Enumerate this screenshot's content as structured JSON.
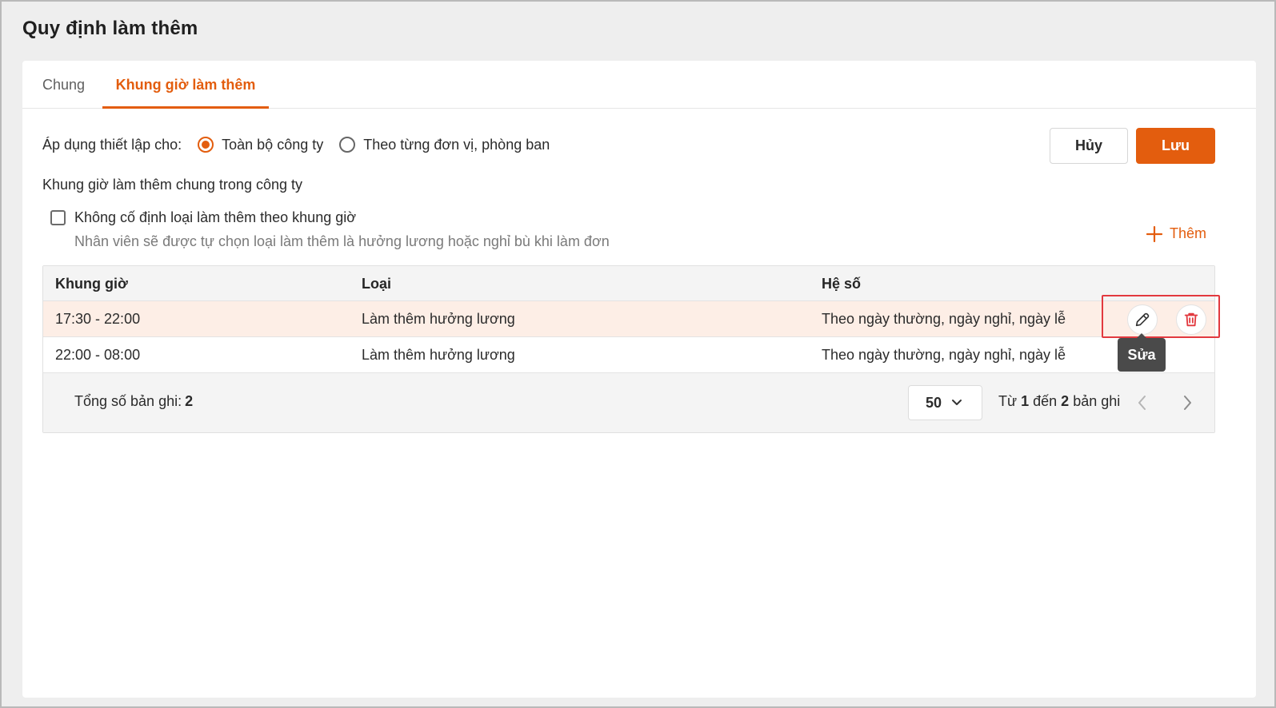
{
  "page": {
    "title": "Quy định làm thêm"
  },
  "tabs": [
    {
      "label": "Chung"
    },
    {
      "label": "Khung giờ làm thêm"
    }
  ],
  "apply": {
    "label": "Áp dụng thiết lập cho:",
    "options": [
      {
        "label": "Toàn bộ công ty",
        "selected": true
      },
      {
        "label": "Theo từng đơn vị, phòng ban",
        "selected": false
      }
    ]
  },
  "actions": {
    "cancel_label": "Hủy",
    "save_label": "Lưu"
  },
  "section": {
    "label": "Khung giờ làm thêm chung trong công ty",
    "checkbox_label": "Không cố định loại làm thêm theo khung giờ",
    "checkbox_checked": false,
    "hint": "Nhân viên sẽ được tự chọn loại làm thêm là hưởng lương hoặc nghỉ bù khi làm đơn",
    "add_label": "Thêm"
  },
  "table": {
    "columns": [
      "Khung giờ",
      "Loại",
      "Hệ số"
    ],
    "rows": [
      {
        "time": "17:30 - 22:00",
        "type": "Làm thêm hưởng lương",
        "coef": "Theo ngày thường, ngày nghỉ, ngày lễ"
      },
      {
        "time": "22:00 - 08:00",
        "type": "Làm thêm hưởng lương",
        "coef": "Theo ngày thường, ngày nghỉ, ngày lễ"
      }
    ],
    "tooltip": "Sửa"
  },
  "footer": {
    "total_label": "Tổng số bản ghi:",
    "total": "2",
    "page_size": "50",
    "range_from_word": "Từ",
    "range_start": "1",
    "range_to_word": "đến",
    "range_end": "2",
    "range_suffix": "bản ghi"
  },
  "colors": {
    "accent": "#e35d0e",
    "highlight_row": "#fdeee6",
    "annotation": "#e2393f"
  }
}
